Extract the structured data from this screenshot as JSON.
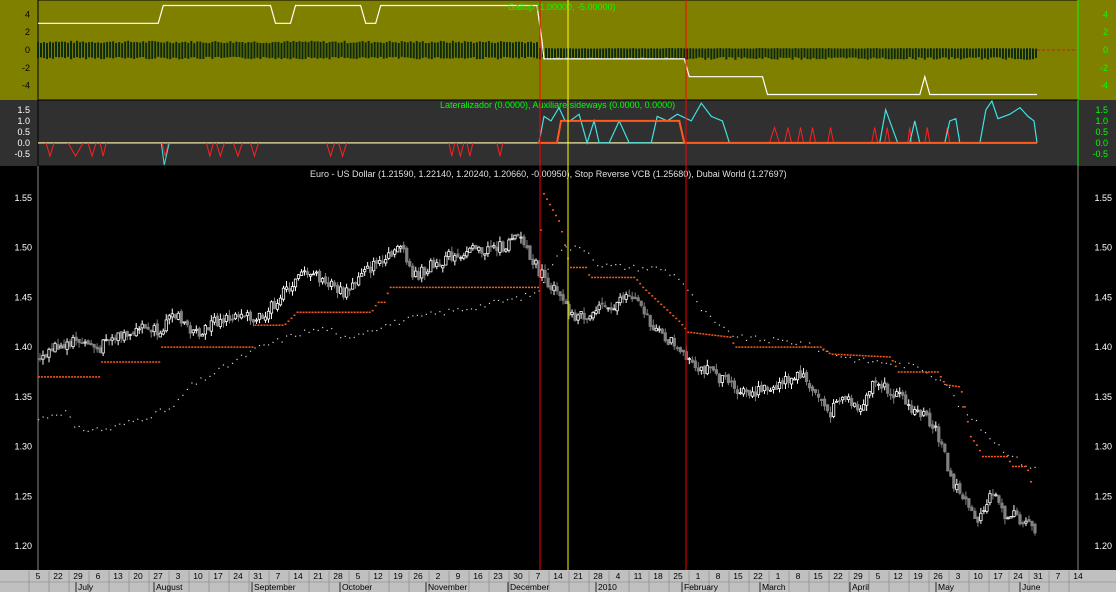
{
  "colors": {
    "top_panel_bg": "#808000",
    "mid_panel_bg": "#303030",
    "main_bg": "#000000",
    "axis_bg": "#c0c0c0",
    "up_candle": "#ffffff",
    "down_candle": "#808080",
    "stop_dots": "#ff5a1e",
    "aux_dots": "#d8d8d8",
    "cursor_red": "#ff0000",
    "cursor_yellow": "#ffff00",
    "green_text": "#00ff00",
    "cyan_line": "#40e0e0",
    "orange_line": "#ff5a1e",
    "red_line": "#ff2020"
  },
  "panels": {
    "top": {
      "legend": "Gallup (1.00000, -5.00000)",
      "ticks": [
        "4",
        "2",
        "0",
        "-2",
        "-4"
      ]
    },
    "mid": {
      "legend": "Lateralizador (0.0000), Auxiliare sideways (0.0000, 0.0000)",
      "ticks": [
        "1.5",
        "1.0",
        "0.5",
        "0.0",
        "-0.5"
      ]
    },
    "main": {
      "legend": "Euro - US Dollar (1.21590, 1.22140, 1.20240, 1.20660, -0.00950), Stop Reverse VCB (1.25680), Dubai World (1.27697)",
      "ticks": [
        "1.55",
        "1.50",
        "1.45",
        "1.40",
        "1.35",
        "1.30",
        "1.25",
        "1.20"
      ]
    }
  },
  "x_axis": {
    "days": [
      "5",
      "22",
      "29",
      "6",
      "13",
      "20",
      "27",
      "3",
      "10",
      "17",
      "24",
      "31",
      "7",
      "14",
      "21",
      "28",
      "5",
      "12",
      "19",
      "26",
      "2",
      "9",
      "16",
      "23",
      "30",
      "7",
      "14",
      "21",
      "28",
      "4",
      "11",
      "18",
      "25",
      "1",
      "8",
      "15",
      "22",
      "1",
      "8",
      "15",
      "22",
      "29",
      "5",
      "12",
      "19",
      "26",
      "3",
      "10",
      "17",
      "24",
      "31",
      "7",
      "14"
    ],
    "months": [
      "July",
      "August",
      "September",
      "October",
      "November",
      "December",
      "2010",
      "February",
      "March",
      "April",
      "May",
      "June"
    ]
  },
  "chart_data": [
    {
      "type": "line",
      "name": "Gallup",
      "title": "Gallup (1.00000, -5.00000)",
      "ylim": [
        -5.5,
        5.5
      ],
      "yticks": [
        4,
        2,
        0,
        -2,
        -4
      ],
      "series": [
        {
          "name": "Gallup",
          "points": [
            [
              0,
              3
            ],
            [
              120,
              3
            ],
            [
              125,
              5
            ],
            [
              232,
              5
            ],
            [
              237,
              3
            ],
            [
              252,
              3
            ],
            [
              257,
              5
            ],
            [
              322,
              5
            ],
            [
              327,
              3
            ],
            [
              337,
              3
            ],
            [
              342,
              5
            ],
            [
              498,
              5
            ],
            [
              503,
              1
            ],
            [
              505,
              -1
            ],
            [
              645,
              -1
            ],
            [
              650,
              -3
            ],
            [
              723,
              -3
            ],
            [
              728,
              -5
            ],
            [
              880,
              -5
            ],
            [
              885,
              -3
            ],
            [
              890,
              -5
            ],
            [
              997,
              -5
            ]
          ]
        }
      ]
    },
    {
      "type": "line",
      "name": "Lateralizador",
      "title": "Lateralizador (0.0000), Auxiliare sideways (0.0000, 0.0000)",
      "ylim": [
        -1.0,
        1.9
      ],
      "yticks": [
        1.5,
        1.0,
        0.5,
        0.0,
        -0.5
      ]
    },
    {
      "type": "candlestick",
      "title": "Euro - US Dollar (1.21590, 1.22140, 1.20240, 1.20660, -0.00950), Stop Reverse VCB (1.25680), Dubai World (1.27697)",
      "ylim": [
        1.18,
        1.58
      ],
      "yticks": [
        1.55,
        1.5,
        1.45,
        1.4,
        1.35,
        1.3,
        1.25,
        1.2
      ],
      "last": {
        "open": 1.2159,
        "high": 1.2214,
        "low": 1.2024,
        "close": 1.2066,
        "change": -0.0095
      },
      "close_path": [
        [
          0,
          1.39
        ],
        [
          20,
          1.402
        ],
        [
          40,
          1.408
        ],
        [
          60,
          1.398
        ],
        [
          80,
          1.412
        ],
        [
          100,
          1.42
        ],
        [
          120,
          1.418
        ],
        [
          140,
          1.433
        ],
        [
          155,
          1.413
        ],
        [
          175,
          1.425
        ],
        [
          195,
          1.43
        ],
        [
          215,
          1.428
        ],
        [
          230,
          1.437
        ],
        [
          250,
          1.46
        ],
        [
          270,
          1.478
        ],
        [
          285,
          1.467
        ],
        [
          305,
          1.455
        ],
        [
          330,
          1.478
        ],
        [
          350,
          1.495
        ],
        [
          365,
          1.5
        ],
        [
          375,
          1.47
        ],
        [
          395,
          1.483
        ],
        [
          415,
          1.493
        ],
        [
          440,
          1.497
        ],
        [
          460,
          1.5
        ],
        [
          482,
          1.51
        ],
        [
          498,
          1.48
        ],
        [
          510,
          1.465
        ],
        [
          520,
          1.45
        ],
        [
          532,
          1.43
        ],
        [
          550,
          1.433
        ],
        [
          570,
          1.44
        ],
        [
          590,
          1.452
        ],
        [
          605,
          1.435
        ],
        [
          620,
          1.413
        ],
        [
          640,
          1.4
        ],
        [
          660,
          1.38
        ],
        [
          680,
          1.37
        ],
        [
          700,
          1.357
        ],
        [
          720,
          1.355
        ],
        [
          740,
          1.363
        ],
        [
          760,
          1.375
        ],
        [
          780,
          1.348
        ],
        [
          790,
          1.333
        ],
        [
          805,
          1.35
        ],
        [
          820,
          1.34
        ],
        [
          835,
          1.365
        ],
        [
          850,
          1.358
        ],
        [
          870,
          1.34
        ],
        [
          885,
          1.33
        ],
        [
          895,
          1.322
        ],
        [
          905,
          1.29
        ],
        [
          913,
          1.262
        ],
        [
          920,
          1.255
        ],
        [
          928,
          1.24
        ],
        [
          935,
          1.225
        ],
        [
          945,
          1.24
        ],
        [
          955,
          1.26
        ],
        [
          962,
          1.233
        ],
        [
          975,
          1.23
        ],
        [
          990,
          1.22
        ],
        [
          997,
          1.207
        ]
      ],
      "series": [
        {
          "name": "Stop Reverse VCB",
          "last": 1.2568,
          "segments": [
            [
              0,
              1.37
            ],
            [
              62,
              1.37
            ],
            [
              62,
              1.385
            ],
            [
              120,
              1.385
            ],
            [
              120,
              1.4
            ],
            [
              215,
              1.4
            ],
            [
              215,
              1.422
            ],
            [
              245,
              1.422
            ],
            [
              258,
              1.435
            ],
            [
              332,
              1.435
            ],
            [
              338,
              1.445
            ],
            [
              345,
              1.445
            ],
            [
              350,
              1.46
            ],
            [
              498,
              1.46
            ],
            [
              503,
              1.556
            ],
            [
              520,
              1.525
            ],
            [
              530,
              1.48
            ],
            [
              546,
              1.48
            ],
            [
              550,
              1.47
            ],
            [
              595,
              1.47
            ],
            [
              603,
              1.46
            ],
            [
              640,
              1.425
            ],
            [
              648,
              1.415
            ],
            [
              690,
              1.41
            ],
            [
              695,
              1.4
            ],
            [
              780,
              1.4
            ],
            [
              790,
              1.393
            ],
            [
              850,
              1.39
            ],
            [
              858,
              1.375
            ],
            [
              897,
              1.375
            ],
            [
              905,
              1.362
            ],
            [
              920,
              1.36
            ],
            [
              930,
              1.31
            ],
            [
              937,
              1.3
            ],
            [
              942,
              1.29
            ],
            [
              966,
              1.29
            ],
            [
              972,
              1.28
            ],
            [
              986,
              1.28
            ],
            [
              992,
              1.257
            ]
          ]
        },
        {
          "name": "Dubai World",
          "last": 1.27697,
          "segments": [
            [
              0,
              1.328
            ],
            [
              20,
              1.335
            ],
            [
              30,
              1.335
            ],
            [
              35,
              1.318
            ],
            [
              70,
              1.318
            ],
            [
              135,
              1.34
            ],
            [
              150,
              1.36
            ],
            [
              185,
              1.38
            ],
            [
              220,
              1.4
            ],
            [
              262,
              1.415
            ],
            [
              290,
              1.42
            ],
            [
              300,
              1.408
            ],
            [
              330,
              1.418
            ],
            [
              355,
              1.425
            ],
            [
              390,
              1.433
            ],
            [
              430,
              1.44
            ],
            [
              480,
              1.45
            ],
            [
              498,
              1.455
            ],
            [
              520,
              1.5
            ],
            [
              545,
              1.5
            ],
            [
              560,
              1.483
            ],
            [
              600,
              1.48
            ],
            [
              620,
              1.48
            ],
            [
              640,
              1.47
            ],
            [
              660,
              1.44
            ],
            [
              680,
              1.42
            ],
            [
              700,
              1.41
            ],
            [
              760,
              1.405
            ],
            [
              790,
              1.395
            ],
            [
              820,
              1.387
            ],
            [
              850,
              1.385
            ],
            [
              880,
              1.38
            ],
            [
              905,
              1.365
            ],
            [
              920,
              1.34
            ],
            [
              940,
              1.32
            ],
            [
              960,
              1.3
            ],
            [
              980,
              1.285
            ],
            [
              997,
              1.277
            ]
          ]
        }
      ]
    }
  ]
}
